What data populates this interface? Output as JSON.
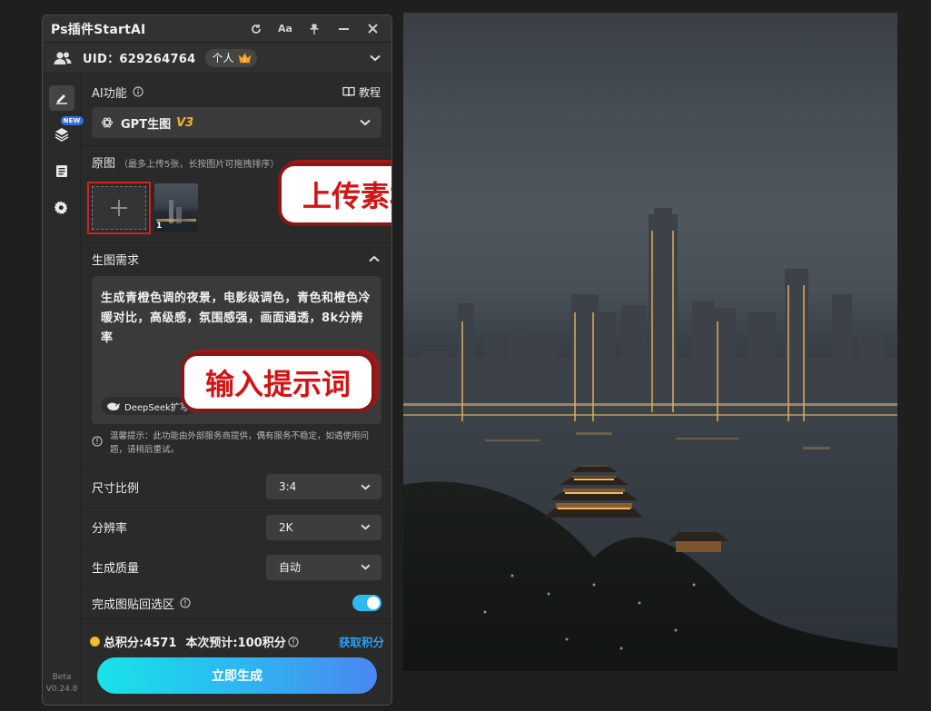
{
  "window": {
    "title": "Ps插件StartAI",
    "buttons": [
      "refresh-icon",
      "font-size-icon",
      "pin-icon",
      "minimize-icon",
      "close-icon"
    ]
  },
  "user": {
    "uid_text": "UID：629264764",
    "plan_label": "个人"
  },
  "sidebar": {
    "items": [
      "edit-icon",
      "layers-icon",
      "notes-icon",
      "settings-icon"
    ],
    "new_badge": "NEW",
    "version_beta": "Beta",
    "version_number": "V0.24.8"
  },
  "ai_function": {
    "label": "AI功能",
    "tutorial_label": "教程",
    "selected_model": "GPT生图",
    "model_version": "V3"
  },
  "source_image": {
    "label": "原图",
    "hint": "（最多上传5张，长按图片可拖拽排序）",
    "thumbnail_number": "1",
    "callout_text": "上传素材图"
  },
  "generation": {
    "label": "生图需求",
    "prompt": "生成青橙色调的夜景，电影级调色，青色和橙色冷暖对比，高级感，氛围感强，画面通透，8k分辨率",
    "deepseek_label": "DeepSeek扩写",
    "callout_text": "输入提示词",
    "notice": "温馨提示：此功能由外部服务商提供，偶有服务不稳定，如遇使用问题，请稍后重试。"
  },
  "options": {
    "ratio_label": "尺寸比例",
    "ratio_value": "3:4",
    "resolution_label": "分辨率",
    "resolution_value": "2K",
    "quality_label": "生成质量",
    "quality_value": "自动",
    "paste_back_label": "完成图贴回选区",
    "paste_back_enabled": true
  },
  "footer": {
    "total_points": "总积分:4571",
    "estimate": "本次预计:100积分",
    "get_points_label": "获取积分",
    "generate_label": "立即生成"
  },
  "colors": {
    "accent_blue": "#2ea0ef",
    "highlight_red": "#d92020",
    "v3_gold": "#f0b32a"
  }
}
